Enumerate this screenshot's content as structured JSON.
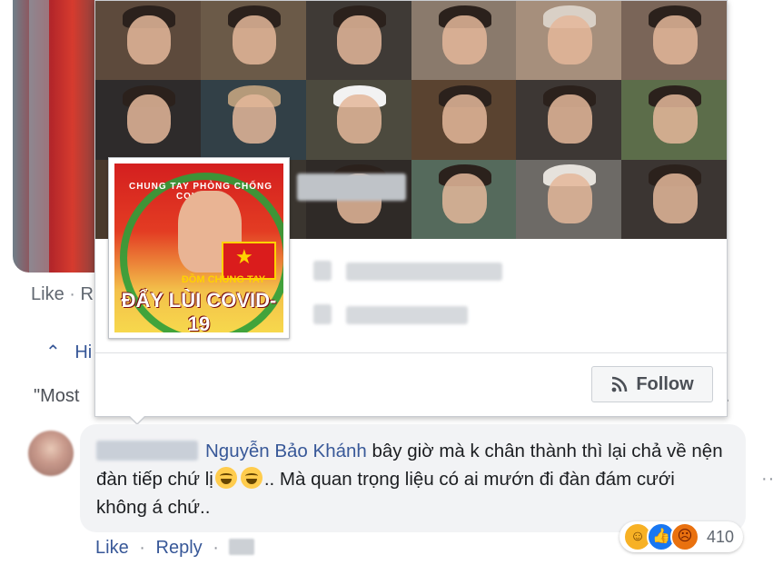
{
  "background_post": {
    "like_label": "Like",
    "reply_fragment": "R",
    "hide_replies_fragment": "Hi",
    "quote_fragment": "\"Most"
  },
  "hovercard": {
    "avatar": {
      "ring_text": "CHUNG TAY PHÒNG CHỐNG COVID-19",
      "sub_text": "ĐỒM CHUNG TAY",
      "main_text": "ĐẨY LÙI COVID-19"
    },
    "follow_label": "Follow",
    "icons": {
      "follow": "rss-feed-icon"
    }
  },
  "comment": {
    "mention": "Nguyễn Bảo Khánh",
    "text_part1": " bây giờ mà k chân thành thì lại chả về nện đàn tiếp chứ lị",
    "text_part2": ".. Mà quan trọng liệu có ai mướn đi đàn đám cưới không á chứ..",
    "reaction_count": "410",
    "like_label": "Like",
    "reply_label": "Reply",
    "separator": "·"
  },
  "colors": {
    "link": "#385898",
    "bubble": "#f2f3f5",
    "muted": "#606770"
  }
}
